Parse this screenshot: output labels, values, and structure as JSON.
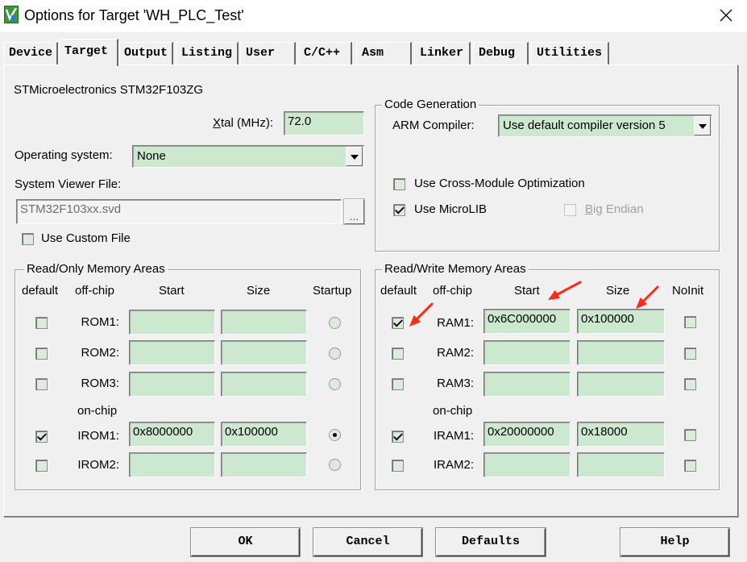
{
  "colors": {
    "dialog_bg": "#f0f0f0",
    "input_bg": "#cce8cf",
    "annotation": "#ff2a1a"
  },
  "window": {
    "title": "Options for Target 'WH_PLC_Test'",
    "app_icon": "keil-uvision-icon",
    "close_icon": "close-icon"
  },
  "tabs": [
    {
      "label": "Device",
      "selected": false
    },
    {
      "label": "Target",
      "selected": true
    },
    {
      "label": "Output",
      "selected": false
    },
    {
      "label": "Listing",
      "selected": false
    },
    {
      "label": "User",
      "selected": false
    },
    {
      "label": "C/C++",
      "selected": false
    },
    {
      "label": "Asm",
      "selected": false
    },
    {
      "label": "Linker",
      "selected": false
    },
    {
      "label": "Debug",
      "selected": false
    },
    {
      "label": "Utilities",
      "selected": false
    }
  ],
  "target": {
    "device_name": "STMicroelectronics STM32F103ZG",
    "xtal_label": "Xtal (MHz):",
    "xtal_value": "72.0",
    "os_label": "Operating system:",
    "os_value": "None",
    "svd_label": "System Viewer File:",
    "svd_value": "STM32F103xx.svd",
    "browse_label": "...",
    "custom_file": {
      "label": "Use Custom File",
      "checked": false
    }
  },
  "code_generation": {
    "title": "Code Generation",
    "compiler_label": "ARM Compiler:",
    "compiler_value": "Use default compiler version 5",
    "cross_module": {
      "label": "Use Cross-Module Optimization",
      "checked": false
    },
    "microlib": {
      "label": "Use MicroLIB",
      "checked": true
    },
    "big_endian": {
      "label": "Big Endian",
      "checked": false,
      "enabled": false
    }
  },
  "ro_memory": {
    "title": "Read/Only Memory Areas",
    "headers": {
      "default": "default",
      "offchip": "off-chip",
      "start": "Start",
      "size": "Size",
      "startup": "Startup"
    },
    "onchip_label": "on-chip",
    "offchip_rows": [
      {
        "label": "ROM1:",
        "default": false,
        "start": "",
        "size": "",
        "startup": false
      },
      {
        "label": "ROM2:",
        "default": false,
        "start": "",
        "size": "",
        "startup": false
      },
      {
        "label": "ROM3:",
        "default": false,
        "start": "",
        "size": "",
        "startup": false
      }
    ],
    "onchip_rows": [
      {
        "label": "IROM1:",
        "default": true,
        "start": "0x8000000",
        "size": "0x100000",
        "startup": true
      },
      {
        "label": "IROM2:",
        "default": false,
        "start": "",
        "size": "",
        "startup": false
      }
    ]
  },
  "rw_memory": {
    "title": "Read/Write Memory Areas",
    "headers": {
      "default": "default",
      "offchip": "off-chip",
      "start": "Start",
      "size": "Size",
      "noinit": "NoInit"
    },
    "onchip_label": "on-chip",
    "offchip_rows": [
      {
        "label": "RAM1:",
        "default": true,
        "start": "0x6C000000",
        "size": "0x100000",
        "noinit": false
      },
      {
        "label": "RAM2:",
        "default": false,
        "start": "",
        "size": "",
        "noinit": false
      },
      {
        "label": "RAM3:",
        "default": false,
        "start": "",
        "size": "",
        "noinit": false
      }
    ],
    "onchip_rows": [
      {
        "label": "IRAM1:",
        "default": true,
        "start": "0x20000000",
        "size": "0x18000",
        "noinit": false
      },
      {
        "label": "IRAM2:",
        "default": false,
        "start": "",
        "size": "",
        "noinit": false
      }
    ]
  },
  "buttons": {
    "ok": "OK",
    "cancel": "Cancel",
    "defaults": "Defaults",
    "help": "Help"
  }
}
